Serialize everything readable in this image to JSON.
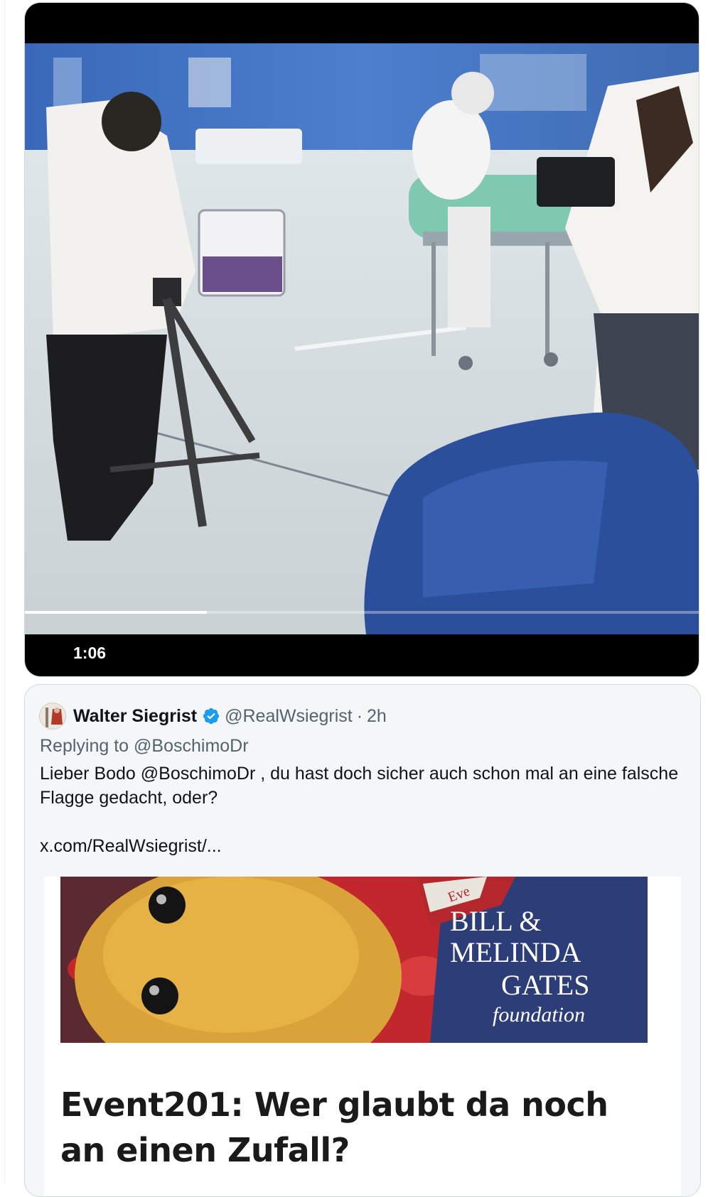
{
  "video": {
    "duration": "1:06",
    "progress_fraction": 0.27
  },
  "quoted_tweet": {
    "author_name": "Walter Siegrist",
    "verified": true,
    "handle": "@RealWsiegrist",
    "separator": "·",
    "time": "2h",
    "replying_prefix": "Replying to",
    "replying_to": "@BoschimoDr",
    "text": "Lieber Bodo @BoschimoDr , du hast doch sicher auch schon mal an eine falsche Flagge gedacht, oder?",
    "link": "x.com/RealWsiegrist/..."
  },
  "article": {
    "image_caption_line1": "BILL &",
    "image_caption_line2": "MELINDA",
    "image_caption_line3": "GATES",
    "image_caption_line4": "foundation",
    "image_tag": "Eve",
    "title": "Event201: Wer glaubt da noch an einen Zufall?"
  },
  "colors": {
    "verified_blue": "#1d9bf0",
    "secondary_text": "#536471",
    "card_border": "#cfd9de",
    "video_background": "#000000"
  },
  "icons": {
    "verified": "verified-badge-icon"
  }
}
